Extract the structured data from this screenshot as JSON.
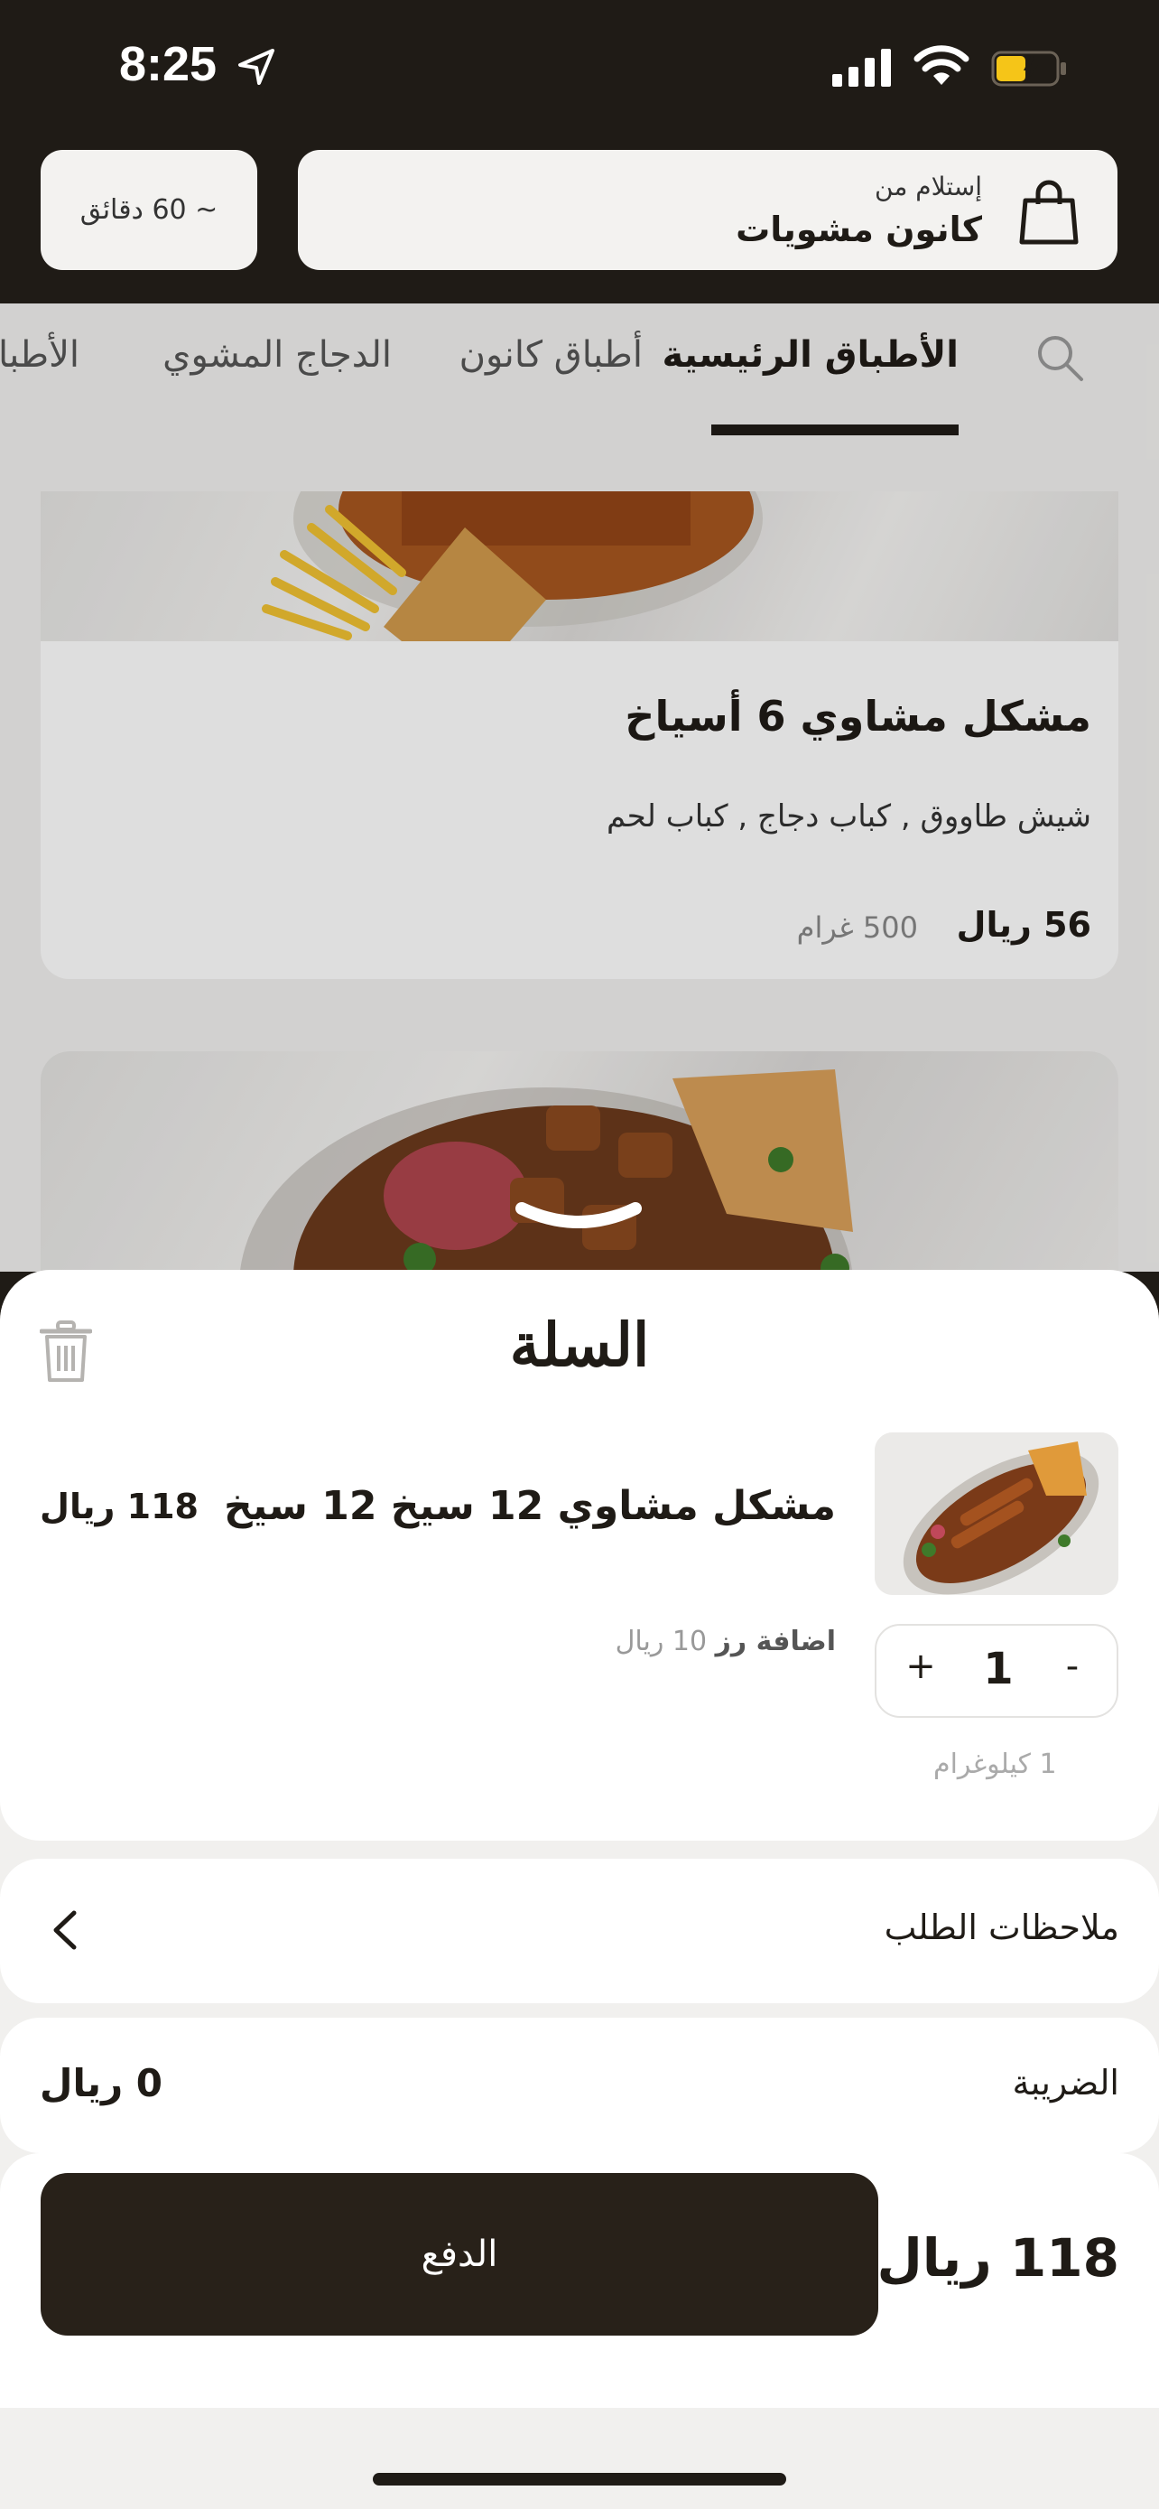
{
  "status_bar": {
    "time": "8:25"
  },
  "header": {
    "pickup_label": "إستلام من",
    "pickup_name": "كانون مشويات",
    "prep_time": "~ 60 دقائق"
  },
  "tabs": [
    {
      "label": "الأطباق الرئيسية",
      "active": true
    },
    {
      "label": "أطباق كانون",
      "active": false
    },
    {
      "label": "الدجاج المشوي",
      "active": false
    },
    {
      "label": "الأطباق",
      "active": false
    }
  ],
  "menu_items": [
    {
      "title": "مشكل مشاوي 6 أسياخ",
      "description": "شيش طاووق , كباب دجاج , كباب لحم",
      "price": "56 ريال",
      "weight": "500 غرام"
    }
  ],
  "cart": {
    "title": "السلة",
    "item": {
      "name": "مشكل مشاوي 12 سيخ 12 سيخ",
      "price": "118 ريال",
      "addon_name": "اضافة رز",
      "addon_price": "10 ريال",
      "quantity": "1",
      "decrement": "-",
      "increment": "+",
      "weight": "1 كيلوغرام"
    },
    "notes_label": "ملاحظات الطلب",
    "tax_label": "الضريبة",
    "tax_value": "0 ريال",
    "pay_label": "الدفع",
    "total": "118 ريال"
  },
  "colors": {
    "dark": "#1f1b16",
    "pay_button": "#282119",
    "battery": "#f5c518"
  }
}
